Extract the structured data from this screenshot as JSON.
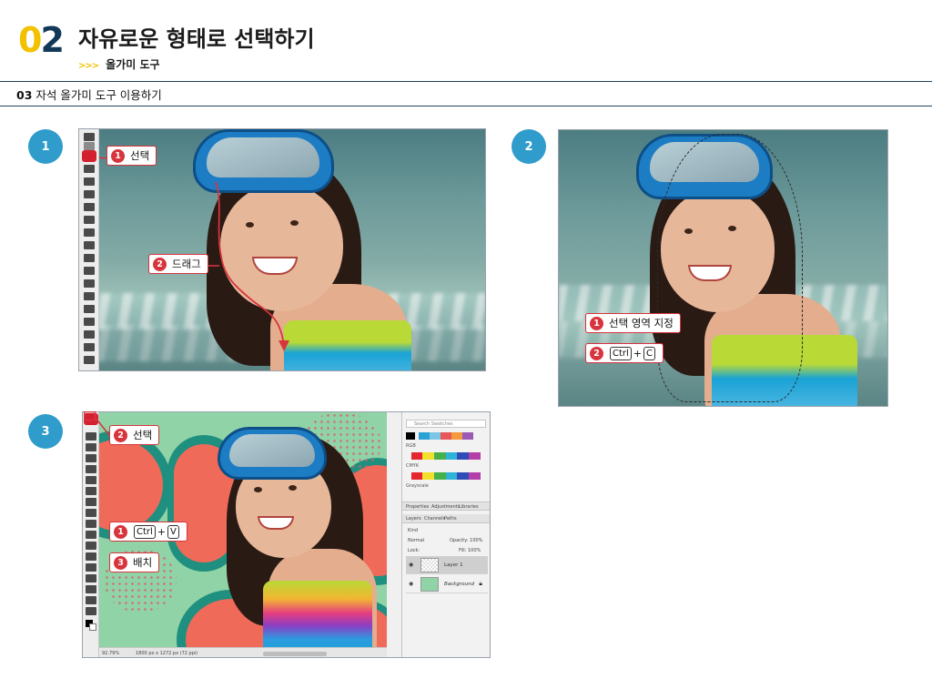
{
  "header": {
    "section_number_first": "0",
    "section_number_second": "2",
    "title": "자유로운 형태로 선택하기",
    "sub_arrow": ">>>",
    "subtitle": "올가미 도구"
  },
  "step_heading": {
    "num": "03",
    "text": "자석 올가미 도구 이용하기"
  },
  "steps": [
    {
      "label": "1"
    },
    {
      "label": "2"
    },
    {
      "label": "3"
    }
  ],
  "callouts": {
    "s1_select": {
      "num": "1",
      "text": "선택"
    },
    "s1_drag": {
      "num": "2",
      "text": "드래그"
    },
    "s2_area": {
      "num": "1",
      "text": "선택 영역 지정"
    },
    "s2_copy": {
      "num": "2",
      "key1": "Ctrl",
      "plus": "+",
      "key2": "C"
    },
    "s3_select": {
      "num": "2",
      "text": "선택"
    },
    "s3_paste": {
      "num": "1",
      "key1": "Ctrl",
      "plus": "+",
      "key2": "V"
    },
    "s3_place": {
      "num": "3",
      "text": "배치"
    }
  },
  "ps_panels": {
    "search_swatches": "Search Swatches",
    "groups": [
      "RGB",
      "CMYK",
      "Grayscale"
    ],
    "tabs": [
      "Properties",
      "Adjustments",
      "Libraries"
    ],
    "layer_tabs": [
      "Layers",
      "Channels",
      "Paths"
    ],
    "kind": "Kind",
    "blend": "Normal",
    "opacity": "Opacity: 100%",
    "lock": "Lock:",
    "fill": "Fill: 100%",
    "layers": [
      "Layer 1",
      "Background"
    ]
  },
  "status": {
    "zoom": "92.79%",
    "size": "1800 px x 1272 px (72 ppi)"
  },
  "colors": {
    "accent_yellow": "#f2c200",
    "navy": "#123a58",
    "step_blue": "#2f9ccb",
    "callout_red": "#d8343d"
  }
}
